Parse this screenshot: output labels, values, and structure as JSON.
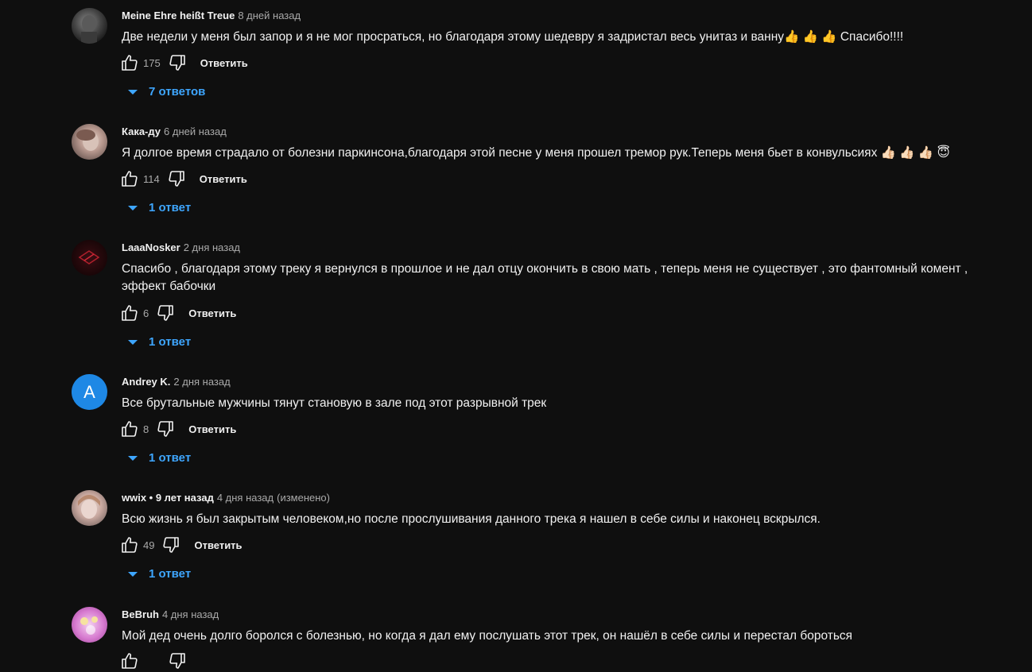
{
  "ui": {
    "reply_label": "Ответить",
    "accent_color": "#3ea6ff",
    "icons": {
      "like": "thumb-up-icon",
      "dislike": "thumb-down-icon",
      "replies": "caret-down-icon"
    }
  },
  "comments": [
    {
      "author": "Meine Ehre heißt Treue",
      "time": "8 дней назад",
      "edited": "",
      "text": "Две недели у меня был запор и я не мог просраться, но благодаря этому шедевру я задристал весь унитаз и ванну👍 👍 👍 Спасибо!!!!",
      "likes": "175",
      "replies": "7 ответов"
    },
    {
      "author": "Кака-ду",
      "time": "6 дней назад",
      "edited": "",
      "text": "Я долгое время страдало от болезни паркинсона,благодаря этой песне у меня прошел тремор рук.Теперь меня бьет в конвульсиях 👍🏻 👍🏻 👍🏻 😇",
      "likes": "114",
      "replies": "1 ответ"
    },
    {
      "author": "LaaaNosker",
      "time": "2 дня назад",
      "edited": "",
      "text": "Спасибо , благодаря этому треку я вернулся в прошлое и не дал отцу окончить в свою мать , теперь меня не существует , это фантомный комент , эффект бабочки",
      "likes": "6",
      "replies": "1 ответ"
    },
    {
      "author": "Andrey K.",
      "time": "2 дня назад",
      "edited": "",
      "avatar_letter": "A",
      "text": "Все брутальные мужчины тянут становую в зале под этот разрывной трек",
      "likes": "8",
      "replies": "1 ответ"
    },
    {
      "author": "wwix • 9 лет назад",
      "time": "4 дня назад",
      "edited": "(изменено)",
      "text": "Всю жизнь я был закрытым человеком,но после прослушивания данного трека я нашел в себе силы и наконец вскрылся.",
      "likes": "49",
      "replies": "1 ответ"
    },
    {
      "author": "BeBruh",
      "time": "4 дня назад",
      "edited": "",
      "text": "Мой дед очень долго боролся с болезнью, но когда я дал ему послушать  этот трек, он нашёл в себе силы и перестал бороться",
      "likes": "",
      "replies": ""
    }
  ]
}
